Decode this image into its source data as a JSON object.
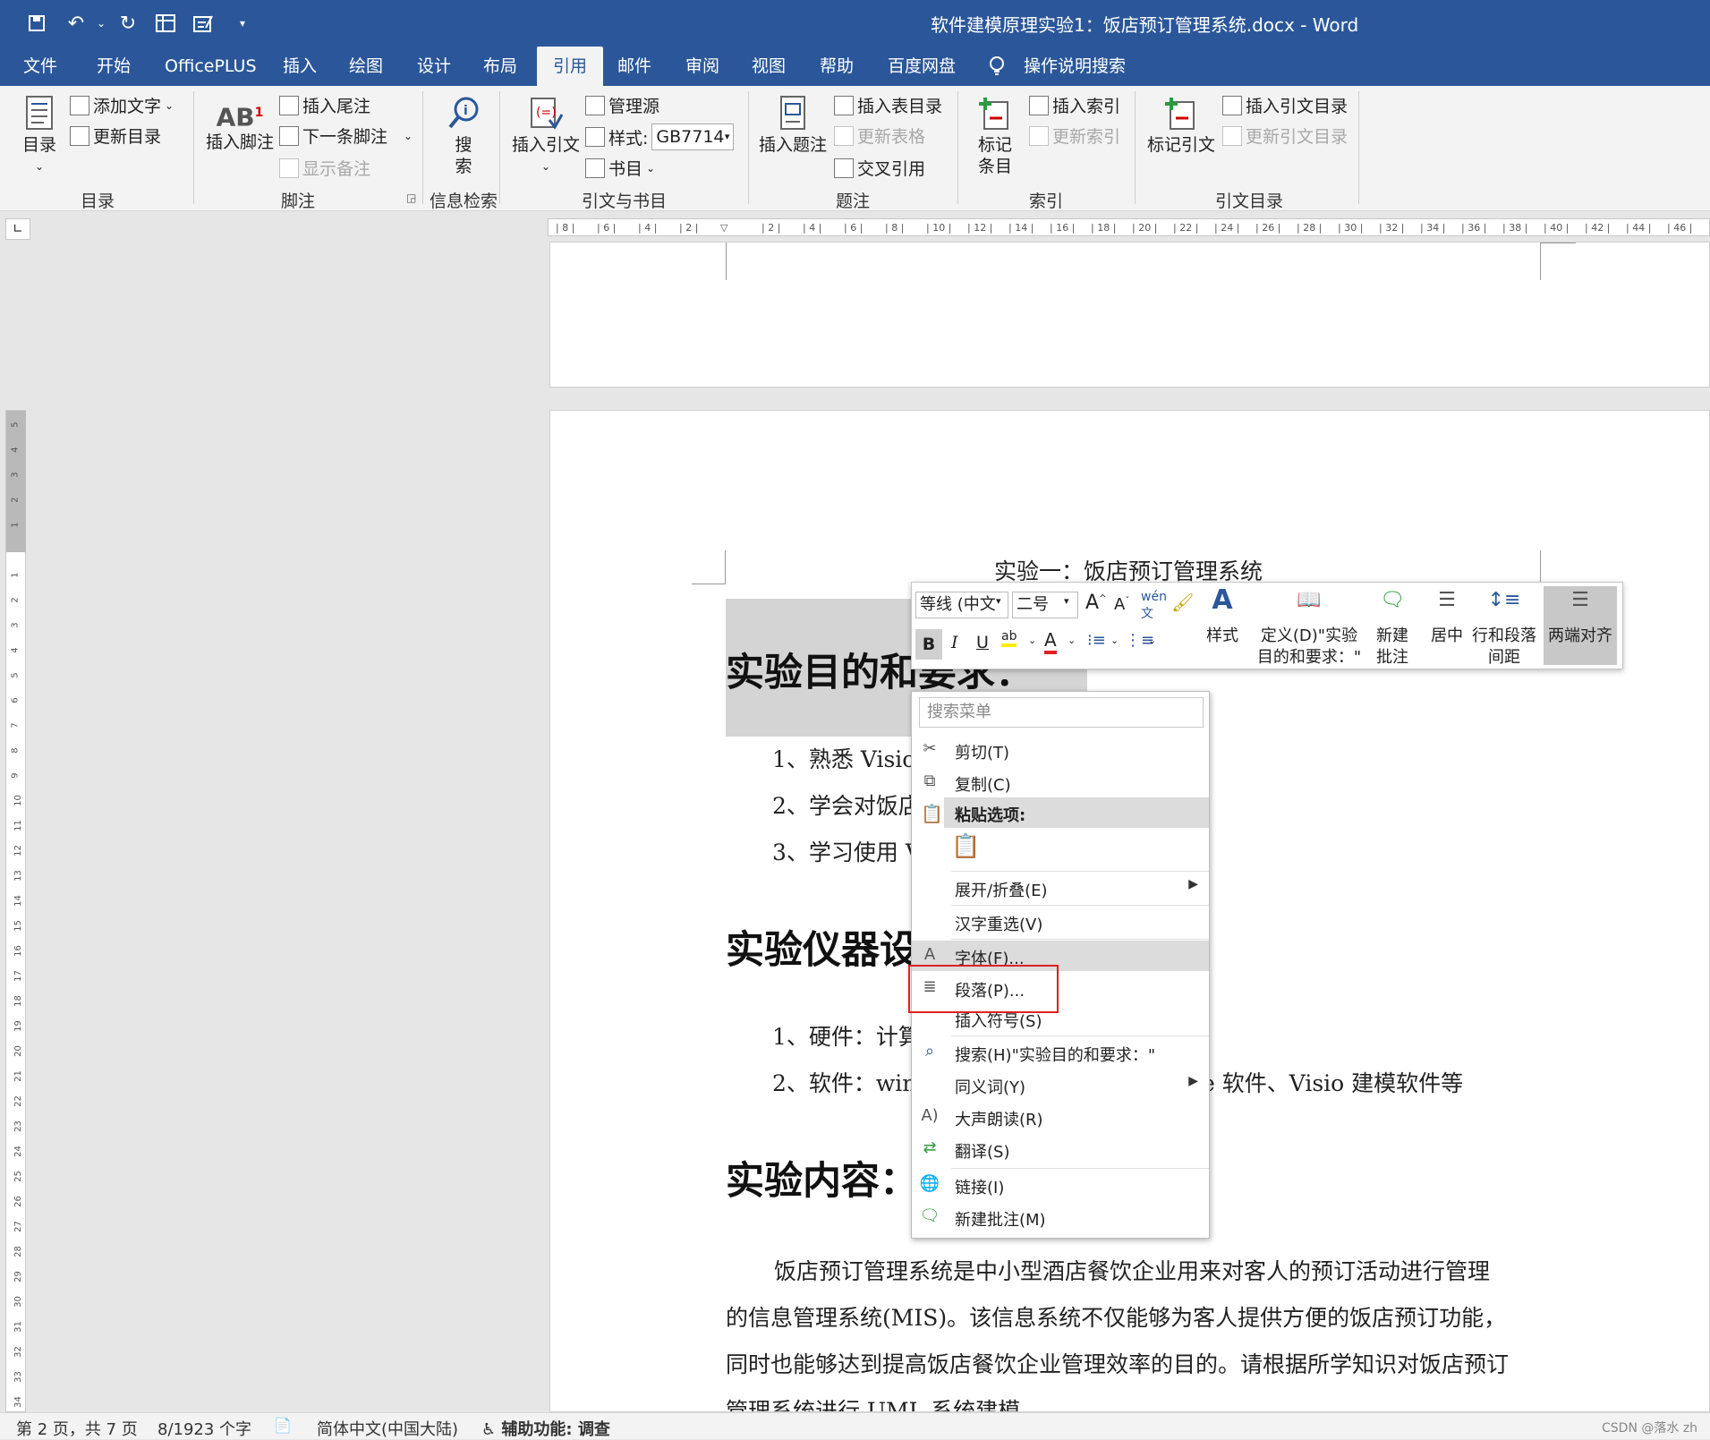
{
  "title": "软件建模原理实验1：饭店预订管理系统.docx  -  Word",
  "quick_access": [
    "save-icon",
    "undo-icon",
    "redo-icon",
    "table-icon",
    "form-icon",
    "customize-icon"
  ],
  "tabs": [
    "文件",
    "开始",
    "OfficePLUS",
    "插入",
    "绘图",
    "设计",
    "布局",
    "引用",
    "邮件",
    "审阅",
    "视图",
    "帮助",
    "百度网盘",
    "操作说明搜索"
  ],
  "active_tab": "引用",
  "ribbon": {
    "toc": {
      "big": "目录",
      "add_text": "添加文字",
      "update": "更新目录",
      "group": "目录"
    },
    "footnote": {
      "insert": "插入脚注",
      "endnote": "插入尾注",
      "next": "下一条脚注",
      "show": "显示备注",
      "group": "脚注"
    },
    "research": {
      "search": "搜索",
      "group": "信息检索"
    },
    "citations": {
      "insert": "插入引文",
      "manage": "管理源",
      "style_label": "样式:",
      "style_value": "GB7714",
      "biblio": "书目",
      "group": "引文与书目"
    },
    "captions": {
      "insert": "插入题注",
      "table_figs": "插入表目录",
      "update_table": "更新表格",
      "cross_ref": "交叉引用",
      "group": "题注"
    },
    "index": {
      "mark": "标记条目",
      "insert": "插入索引",
      "update": "更新索引",
      "group": "索引"
    },
    "authorities": {
      "mark": "标记引文",
      "insert": "插入引文目录",
      "update": "更新引文目录",
      "group": "引文目录"
    }
  },
  "document": {
    "title_line": "实验一：饭店预订管理系统",
    "heading1": "实验目的和要求：",
    "items1": [
      "1、熟悉 Visio",
      "2、学会对饭店",
      "3、学习使用 V"
    ],
    "heading2": "实验仪器设",
    "items2": [
      "1、硬件：计算",
      "2、软件：win"
    ],
    "items2_tail": "e 软件、Visio 建模软件等",
    "heading3": "实验内容：",
    "para": [
      "饭店预订管理系统是中小型酒店餐饮企业用来对客人的预订活动进行管理",
      "的信息管理系统(MIS)。该信息系统不仅能够为客人提供方便的饭店预订功能，",
      "同时也能够达到提高饭店餐饮企业管理效率的目的。请根据所学知识对饭店预订",
      "管理系统进行 UML 系统建模。"
    ]
  },
  "minibar": {
    "font": "等线 (中文",
    "size": "二号",
    "styles": "样式",
    "define": "定义(D)\"实验目的和要求：\"",
    "new_comment": "新建批注",
    "center": "居中",
    "line_spacing": "行和段落间距",
    "justify": "两端对齐",
    "bold": "B",
    "italic": "I",
    "underline": "U"
  },
  "context_menu": {
    "search_placeholder": "搜索菜单",
    "cut": "剪切(T)",
    "copy": "复制(C)",
    "paste_options": "粘贴选项:",
    "expand": "展开/折叠(E)",
    "reconvert": "汉字重选(V)",
    "font": "字体(F)...",
    "paragraph": "段落(P)...",
    "symbol": "插入符号(S)",
    "search": "搜索(H)\"实验目的和要求：\"",
    "synonyms": "同义词(Y)",
    "read_aloud": "大声朗读(R)",
    "translate": "翻译(S)",
    "link": "链接(I)",
    "new_comment": "新建批注(M)"
  },
  "status": {
    "page": "第 2 页，共 7 页",
    "words": "8/1923 个字",
    "language": "简体中文(中国大陆)",
    "accessibility": "辅助功能: 调查",
    "watermark": "CSDN @落水 zh"
  },
  "colors": {
    "title_bar": "#2b579a",
    "highlight_box": "#e02020"
  }
}
